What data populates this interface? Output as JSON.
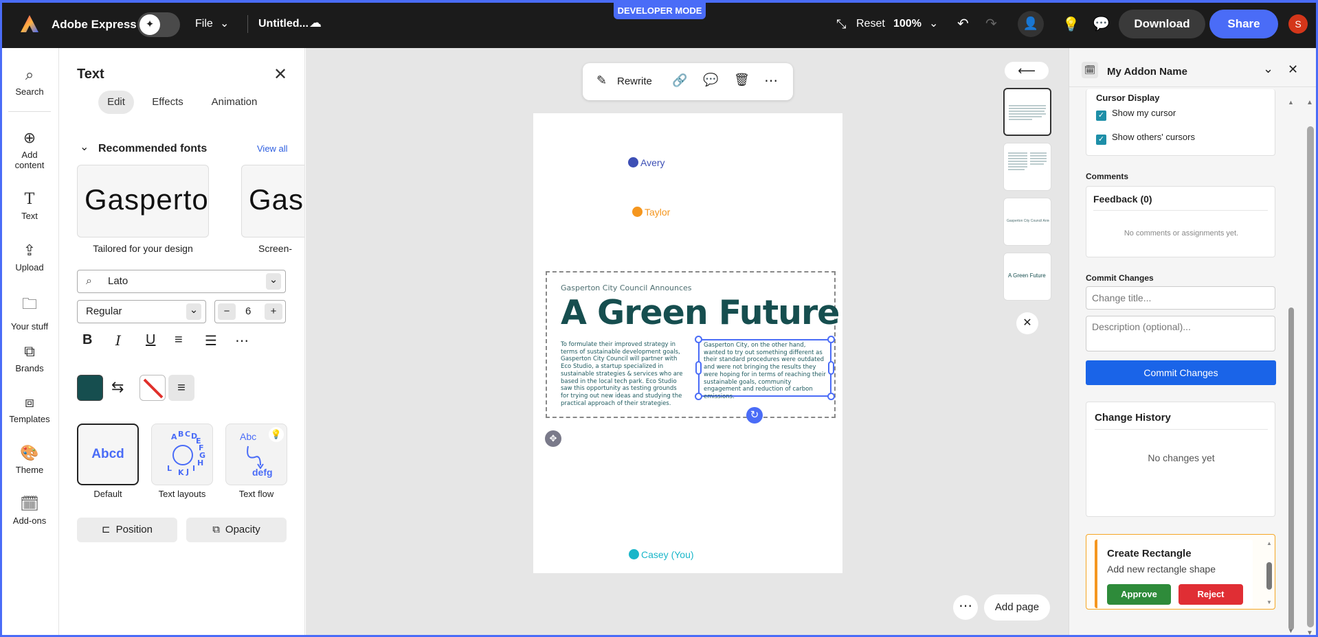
{
  "topbar": {
    "app_name": "Adobe Express",
    "file_menu": "File",
    "doc_title": "Untitled...",
    "developer_mode": "DEVELOPER MODE",
    "reset": "Reset",
    "zoom": "100%",
    "download": "Download",
    "share": "Share",
    "avatar_initial": "S"
  },
  "rail": {
    "items": [
      {
        "label": "Search",
        "icon": "search-icon"
      },
      {
        "label": "Add content",
        "icon": "plus-circle-icon"
      },
      {
        "label": "Text",
        "icon": "text-icon"
      },
      {
        "label": "Upload",
        "icon": "upload-icon"
      },
      {
        "label": "Your stuff",
        "icon": "folder-icon"
      },
      {
        "label": "Brands",
        "icon": "brand-icon"
      },
      {
        "label": "Templates",
        "icon": "templates-icon"
      },
      {
        "label": "Theme",
        "icon": "palette-icon"
      },
      {
        "label": "Add-ons",
        "icon": "addons-icon"
      }
    ]
  },
  "text_panel": {
    "title": "Text",
    "tabs": [
      "Edit",
      "Effects",
      "Animation"
    ],
    "recommended_heading": "Recommended fonts",
    "view_all": "View all",
    "font_cards": [
      {
        "preview": "Gasperton C",
        "caption": "Tailored for your design"
      },
      {
        "preview": "Gaspe",
        "caption": "Screen-"
      }
    ],
    "font_family": "Lato",
    "font_weight": "Regular",
    "font_size": "6",
    "text_styles": [
      {
        "preview": "Abcd",
        "label": "Default"
      },
      {
        "preview": "ABCDEFGHIJKL",
        "label": "Text layouts"
      },
      {
        "preview_top": "Abc",
        "preview_bottom": "defg",
        "label": "Text flow"
      }
    ],
    "position_btn": "Position",
    "opacity_btn": "Opacity",
    "colors": {
      "text_color": "#164e4f",
      "accent": "#4a6cf7"
    }
  },
  "canvas": {
    "toolbar_rewrite": "Rewrite",
    "cursors": [
      {
        "name": "Avery",
        "color": "#3d4fb5"
      },
      {
        "name": "Taylor",
        "color": "#f5961e"
      },
      {
        "name": "Casey (You)",
        "color": "#19b6c9"
      }
    ],
    "eyebrow": "Gasperton City Council Announces",
    "headline": "A Green Future",
    "col1": "To formulate their improved strategy in terms of sustainable development goals, Gasperton City Council will partner with Eco Studio, a startup specialized in sustainable strategies & services who are based in the local tech park. Eco Studio saw this opportunity as testing grounds for trying out new ideas and studying the practical approach of their strategies.",
    "col2": "Gasperton City, on the other hand, wanted to try out something different as their standard procedures were outdated and were not bringing the results they were hoping for in terms of reaching their sustainable goals, community engagement and reduction of carbon emissions.",
    "thumb3_text": "Gasperton City Council Announces",
    "thumb4_text": "A Green Future",
    "add_page": "Add page"
  },
  "addon": {
    "name": "My Addon Name",
    "cursor_display_heading": "Cursor Display",
    "show_my_cursor": "Show my cursor",
    "show_others_cursors": "Show others' cursors",
    "comments_heading": "Comments",
    "feedback_title": "Feedback (0)",
    "no_comments": "No comments or assignments yet.",
    "commit_heading": "Commit Changes",
    "title_placeholder": "Change title...",
    "desc_placeholder": "Description (optional)...",
    "commit_button": "Commit Changes",
    "history_heading": "Change History",
    "no_changes": "No changes yet",
    "suggestion_title": "Create Rectangle",
    "suggestion_desc": "Add new rectangle shape",
    "approve": "Approve",
    "reject": "Reject"
  }
}
